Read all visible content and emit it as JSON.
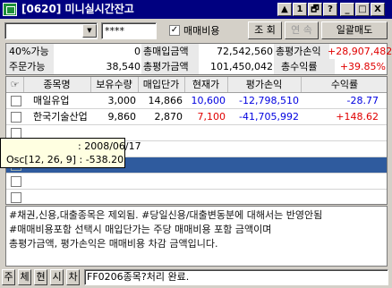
{
  "window": {
    "title": "[0620] 미니실시간잔고",
    "buttons": [
      "▲",
      "1",
      "🗗",
      "?",
      "_",
      "□",
      "X"
    ]
  },
  "controls": {
    "account_value": "",
    "password_mask": "****",
    "fee_checkbox_checked": true,
    "fee_label": "매매비용",
    "query_label": "조 회",
    "continue_label": "연 속",
    "bulk_sell_label": "일괄매도"
  },
  "summary": {
    "row1": {
      "label1": "40%가능",
      "value1": "0",
      "label2": "총매입금액",
      "value2": "72,542,560",
      "label3": "총평가손익",
      "value3": "+28,907,482"
    },
    "row2": {
      "label1": "주문가능",
      "value1": "38,540",
      "label2": "총평가금액",
      "value2": "101,450,042",
      "label3": "총수익률",
      "value3": "+39.85%"
    }
  },
  "table": {
    "columns": [
      "종목명",
      "보유수량",
      "매입단가",
      "현재가",
      "평가손익",
      "수익률"
    ],
    "rows": [
      {
        "name": "매일유업",
        "qty": "3,000",
        "avg_price": "14,866",
        "current": "10,600",
        "pnl": "-12,798,510",
        "rate": "-28.77"
      },
      {
        "name": "한국기술산업",
        "qty": "9,860",
        "avg_price": "2,870",
        "current": "7,100",
        "pnl": "-41,705,992",
        "rate": "+148.62"
      }
    ]
  },
  "tooltip": {
    "date_line": ": 2008/06/17",
    "osc_line": "Osc[12, 26, 9] : -538.20"
  },
  "notice": {
    "line1": "#채권,신용,대출종목은 제외됨.  #당일신용/대출변동분에 대해서는 반영안됨",
    "line2": "#매매비용포함 선택시 매입단가는 주당 매매비용 포함 금액이며",
    "line3": "총평가금액, 평가손익은 매매비용 차감 금액입니다."
  },
  "statusbar": {
    "tabs": [
      "주",
      "체",
      "현",
      "시",
      "차"
    ],
    "message": "FF0206종목?처리 완료."
  },
  "colors": {
    "up": "#e00000",
    "down": "#0000e0",
    "selected_row": "#2f5b9e"
  }
}
